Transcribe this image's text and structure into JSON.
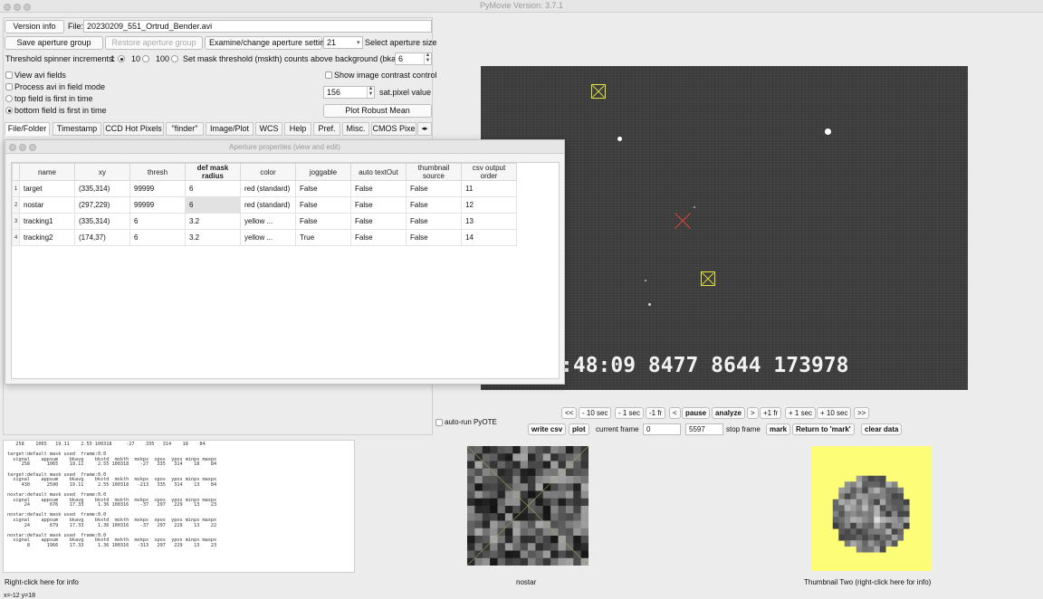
{
  "window": {
    "title": "PyMovie  Version: 3.7.1"
  },
  "top": {
    "version_info": "Version info",
    "file_label": "File:",
    "file_name": "20230209_551_Ortrud_Bender.avi",
    "save_aperture_group": "Save aperture group",
    "restore_aperture_group": "Restore aperture group",
    "examine_change": "Examine/change aperture settings",
    "aperture_size_value": "21",
    "select_aperture_size": "Select aperture size",
    "threshold_label": "Threshold spinner increments:",
    "inc_1": "1",
    "inc_10": "10",
    "inc_100": "100",
    "mskth_label": "Set mask threshold (mskth) counts above background (bkavg)",
    "mskth_value": "6",
    "view_avi_fields": "View avi fields",
    "process_avi_field_mode": "Process avi in field mode",
    "top_field_first": "top field is first in time",
    "bottom_field_first": "bottom field is first in time",
    "show_contrast": "Show image contrast control",
    "sat_value": "156",
    "sat_label": "sat.pixel value",
    "plot_robust_mean": "Plot Robust Mean"
  },
  "tabs": [
    "File/Folder",
    "Timestamp",
    "CCD Hot Pixels",
    "\"finder\"",
    "Image/Plot",
    "WCS",
    "Help",
    "Pref.",
    "Misc.",
    "CMOS Pixe"
  ],
  "aperture_dialog": {
    "title": "Aperture properties (view and edit)",
    "columns": [
      "name",
      "xy",
      "thresh",
      "def mask radius",
      "color",
      "joggable",
      "auto textOut",
      "thumbnail source",
      "csv output order"
    ],
    "rows": [
      {
        "num": "1",
        "cells": [
          "target",
          "(335,314)",
          "99999",
          "6",
          "red (standard)",
          "False",
          "False",
          "False",
          "11"
        ]
      },
      {
        "num": "2",
        "cells": [
          "nostar",
          "(297,229)",
          "99999",
          "6",
          "red (standard)",
          "False",
          "False",
          "False",
          "12"
        ]
      },
      {
        "num": "3",
        "cells": [
          "tracking1",
          "(335,314)",
          "6",
          "3.2",
          "yellow ...",
          "False",
          "False",
          "False",
          "13"
        ]
      },
      {
        "num": "4",
        "cells": [
          "tracking2",
          "(174,37)",
          "6",
          "3.2",
          "yellow ...",
          "True",
          "False",
          "False",
          "14"
        ]
      }
    ]
  },
  "image": {
    "timestamp": ":48:09 8477 8644 173978"
  },
  "playback": {
    "buttons": [
      "<<",
      "- 10 sec",
      "- 1 sec",
      "-1 fr",
      "<",
      "pause",
      "analyze",
      ">",
      "+1 fr",
      "+ 1 sec",
      "+ 10 sec",
      ">>"
    ],
    "auto_run": "auto-run PyOTE",
    "write_csv": "write csv",
    "plot": "plot",
    "current_frame_label": "current frame",
    "current_frame_value": "0",
    "stop_frame_value": "5597",
    "stop_frame_label": "stop frame",
    "mark": "mark",
    "return_to_mark": "Return to 'mark'",
    "clear_data": "clear data"
  },
  "log": {
    "text": "   258    1065   19.11    2.55 100318     -27    335   314    18    84\n\ntarget:default mask used  frame:0.0\n  signal    appsum    bkavg    bkstd  mskth  mskpx  xpos  ypos minpx maxpx\n     258      1065    19.11     2.55 100318    -27   335   314    18    84\n\ntarget:default mask used  frame:0.0\n  signal    appsum    bkavg    bkstd  mskth  mskpx  xpos  ypos minpx maxpx\n     430      2590    19.11     2.55 100318   -213   335   314    13    84\n\nnostar:default mask used  frame:0.0\n  signal    appsum    bkavg    bkstd  mskth  mskpx  xpos  ypos minpx maxpx\n      24       676    17.33     1.36 100316    -37   297   229    13    23\n\nnostar:default mask used  frame:0.0\n  signal    appsum    bkavg    bkstd  mskth  mskpx  xpos  ypos minpx maxpx\n      24       679    17.33     1.36 100316    -37   297   229    13    22\n\nnostar:default mask used  frame:0.0\n  signal    appsum    bkavg    bkstd  mskth  mskpx  xpos  ypos minpx maxpx\n       8      1966    17.33     1.36 100316   -313   297   229    13    23",
    "right_click_info": "Right-click here for info",
    "coords": "x=-12 y=18"
  },
  "thumbnails": {
    "one_label": "nostar",
    "two_label": "Thumbnail Two (right-click here for info)"
  }
}
